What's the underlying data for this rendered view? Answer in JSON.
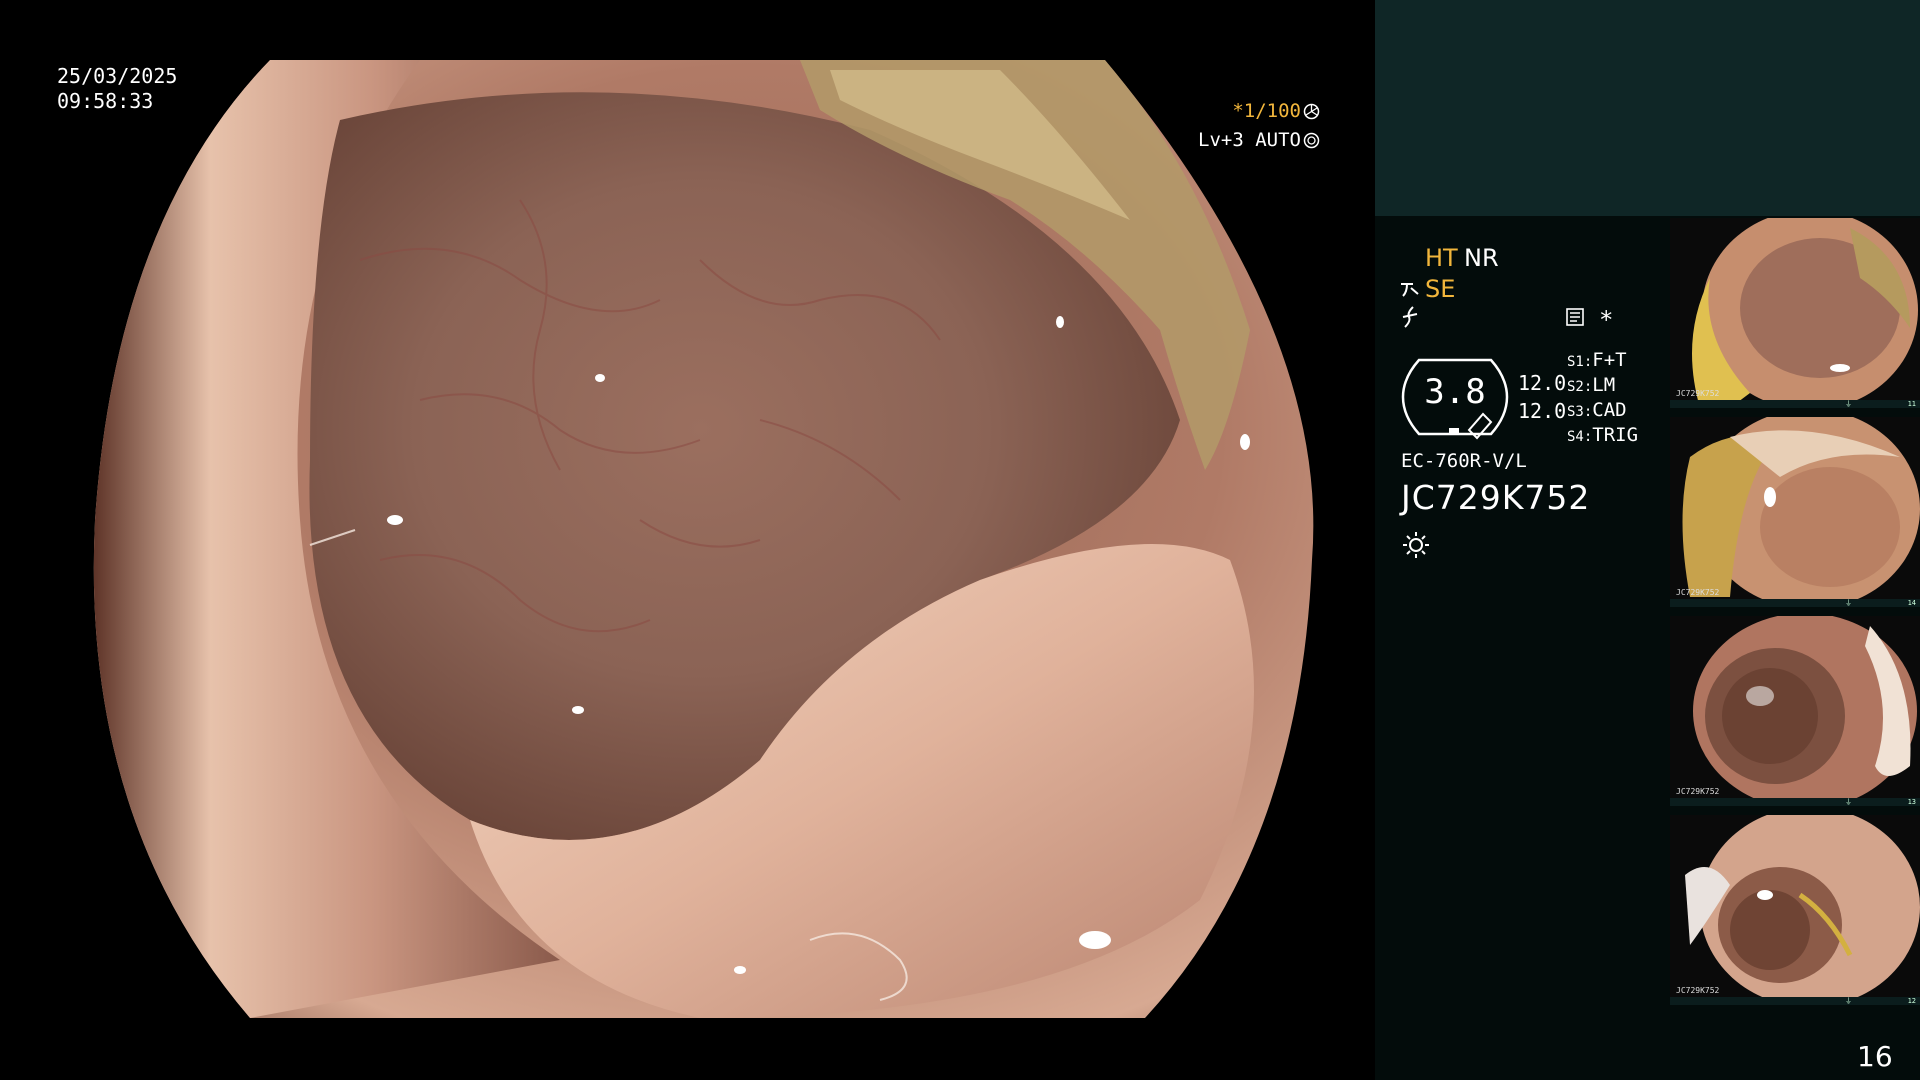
{
  "overlay": {
    "date": "25/03/2025",
    "time": "09:58:33",
    "shutter": "*1/100",
    "iris": "Lv+3 AUTO"
  },
  "panel": {
    "ht": "HT",
    "nr": "NR",
    "se": "SE",
    "star": "*",
    "gauge_value": "3.8",
    "gain_1": "12.0",
    "gain_2": "12.0",
    "switches": [
      {
        "key": "S1:",
        "value": "F+T"
      },
      {
        "key": "S2:",
        "value": "LM"
      },
      {
        "key": "S3:",
        "value": "CAD"
      },
      {
        "key": "S4:",
        "value": "TRIG"
      }
    ],
    "scope_model": "EC-760R-V/L",
    "serial": "JC729K752",
    "page_number": "16"
  },
  "thumbnails": [
    {
      "label": "JC729K752",
      "number": "11"
    },
    {
      "label": "JC729K752",
      "number": "14"
    },
    {
      "label": "JC729K752",
      "number": "13"
    },
    {
      "label": "JC729K752",
      "number": "12"
    }
  ],
  "colors": {
    "accent": "#f2b63c",
    "panel_top": "#0f2626",
    "panel_body": "#030c0b"
  }
}
